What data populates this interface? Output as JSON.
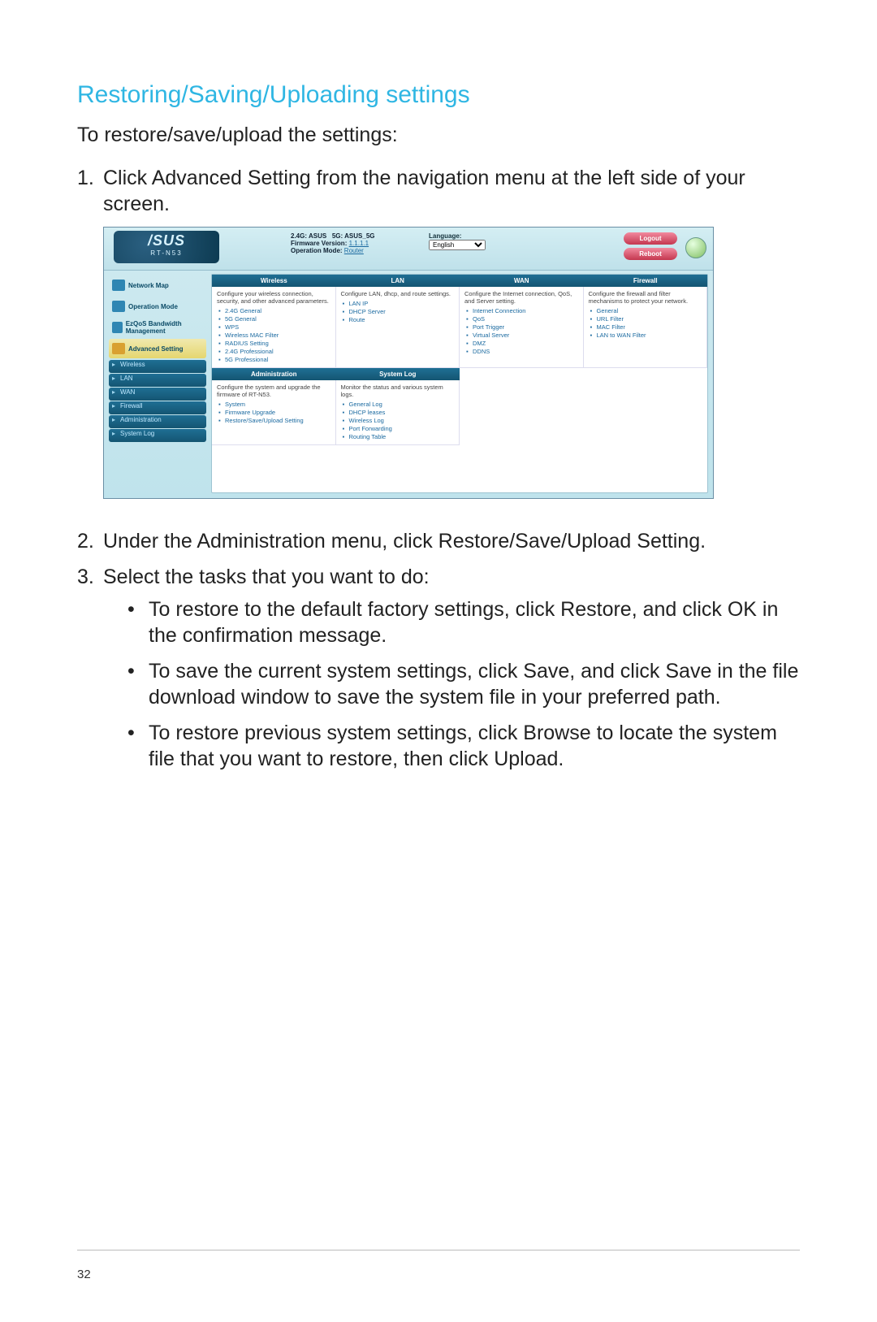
{
  "page_number": "32",
  "heading": "Restoring/Saving/Uploading settings",
  "intro": "To restore/save/upload the settings:",
  "steps": {
    "1": "Click Advanced Setting from the navigation menu at the left side of your screen.",
    "2": "Under the Administration menu, click Restore/Save/Upload Setting.",
    "3": "Select the tasks that you want to do:"
  },
  "bullets": {
    "a": "To restore to the default factory settings, click Restore, and click OK in the confirmation message.",
    "b": "To save the current system settings, click Save, and click Save in the file download window to save the system file in your preferred path.",
    "c": "To restore previous system settings, click Browse to locate the system file that you want to restore, then click Upload."
  },
  "router": {
    "brand": "/SUS",
    "model": "RT-N53",
    "hdr_24g_label": "2.4G:",
    "hdr_24g_val": "ASUS",
    "hdr_5g_label": "5G:",
    "hdr_5g_val": "ASUS_5G",
    "fw_label": "Firmware Version:",
    "fw_val": "1.1.1.1",
    "op_label": "Operation Mode:",
    "op_val": "Router",
    "lang_label": "Language:",
    "lang_val": "English",
    "btn_logout": "Logout",
    "btn_reboot": "Reboot",
    "nav": {
      "map": "Network Map",
      "opmode": "Operation Mode",
      "ezqos": "EzQoS Bandwidth Management",
      "adv": "Advanced Setting",
      "sub": {
        "wireless": "Wireless",
        "lan": "LAN",
        "wan": "WAN",
        "firewall": "Firewall",
        "admin": "Administration",
        "syslog": "System Log"
      }
    },
    "cols": {
      "wireless": {
        "head": "Wireless",
        "desc": "Configure your wireless connection, security, and other advanced parameters.",
        "items": [
          "2.4G General",
          "5G General",
          "WPS",
          "Wireless MAC Filter",
          "RADIUS Setting",
          "2.4G Professional",
          "5G Professional"
        ]
      },
      "lan": {
        "head": "LAN",
        "desc": "Configure LAN, dhcp, and route settings.",
        "items": [
          "LAN IP",
          "DHCP Server",
          "Route"
        ]
      },
      "wan": {
        "head": "WAN",
        "desc": "Configure the Internet connection, QoS, and Server setting.",
        "items": [
          "Internet Connection",
          "QoS",
          "Port Trigger",
          "Virtual Server",
          "DMZ",
          "DDNS"
        ]
      },
      "firewall": {
        "head": "Firewall",
        "desc": "Configure the firewall and filter mechanisms to protect your network.",
        "items": [
          "General",
          "URL Filter",
          "MAC Filter",
          "LAN to WAN Filter"
        ]
      },
      "admin": {
        "head": "Administration",
        "desc": "Configure the system and upgrade the firmware of RT-N53.",
        "items": [
          "System",
          "Firmware Upgrade",
          "Restore/Save/Upload Setting"
        ]
      },
      "syslog": {
        "head": "System Log",
        "desc": "Monitor the status and various system logs.",
        "items": [
          "General Log",
          "DHCP leases",
          "Wireless Log",
          "Port Forwarding",
          "Routing Table"
        ]
      }
    }
  }
}
